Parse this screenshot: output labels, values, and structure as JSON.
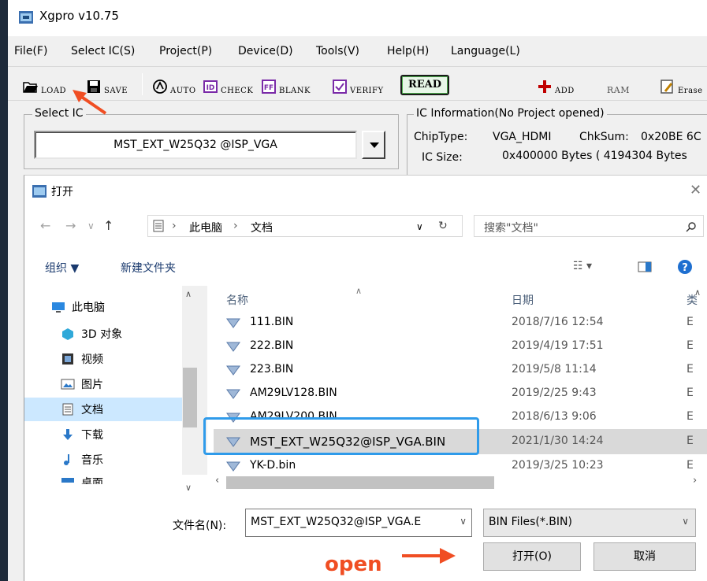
{
  "window": {
    "title": "Xgpro v10.75"
  },
  "menu": [
    "File(F)",
    "Select IC(S)",
    "Project(P)",
    "Device(D)",
    "Tools(V)",
    "Help(H)",
    "Language(L)"
  ],
  "toolbar": {
    "load": "LOAD",
    "save": "SAVE",
    "auto": "AUTO",
    "check": "CHECK",
    "blank": "BLANK",
    "verify": "VERIFY",
    "read": "READ",
    "add": "ADD",
    "ram": "RAM",
    "erase": "Erase"
  },
  "select_ic": {
    "legend": "Select IC",
    "value": "MST_EXT_W25Q32 @ISP_VGA"
  },
  "ic_info": {
    "legend": "IC Information(No Project opened)",
    "chiptype_label": "ChipType:",
    "chiptype_value": "VGA_HDMI",
    "chksum_label": "ChkSum:",
    "chksum_value": "0x20BE 6C",
    "size_label": "IC Size:",
    "size_value": "0x400000 Bytes ( 4194304 Bytes"
  },
  "dialog": {
    "title": "打开",
    "breadcrumb": [
      "此电脑",
      "文档"
    ],
    "search_placeholder": "搜索\"文档\"",
    "organize": "组织 ▼",
    "new_folder": "新建文件夹",
    "nav_items": [
      {
        "label": "此电脑",
        "icon": "computer-icon"
      },
      {
        "label": "3D 对象",
        "icon": "cube-icon"
      },
      {
        "label": "视频",
        "icon": "video-icon"
      },
      {
        "label": "图片",
        "icon": "picture-icon"
      },
      {
        "label": "文档",
        "icon": "document-icon"
      },
      {
        "label": "下载",
        "icon": "download-icon"
      },
      {
        "label": "音乐",
        "icon": "music-icon"
      },
      {
        "label": "桌面",
        "icon": "desktop-icon"
      }
    ],
    "columns": {
      "name": "名称",
      "date": "日期",
      "type": "类"
    },
    "files": [
      {
        "name": "111.BIN",
        "date": "2018/7/16 12:54",
        "type": "E"
      },
      {
        "name": "222.BIN",
        "date": "2019/4/19 17:51",
        "type": "E"
      },
      {
        "name": "223.BIN",
        "date": "2019/5/8 11:14",
        "type": "E"
      },
      {
        "name": "AM29LV128.BIN",
        "date": "2019/2/25 9:43",
        "type": "E"
      },
      {
        "name": "AM29LV200.BIN",
        "date": "2018/6/13 9:06",
        "type": "E"
      },
      {
        "name": "MST_EXT_W25Q32@ISP_VGA.BIN",
        "date": "2021/1/30 14:24",
        "type": "E"
      },
      {
        "name": "YK-D.bin",
        "date": "2019/3/25 10:23",
        "type": "E"
      }
    ],
    "filename_label": "文件名(N):",
    "filename_value": "MST_EXT_W25Q32@ISP_VGA.E",
    "filter": "BIN Files(*.BIN)",
    "open_button": "打开(O)",
    "cancel_button": "取消"
  },
  "annotation": {
    "open": "open"
  }
}
